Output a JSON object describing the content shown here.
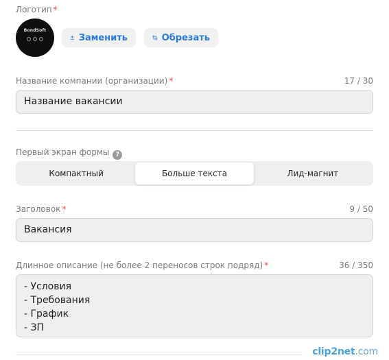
{
  "logo": {
    "label": "Логотип",
    "required_mark": "*",
    "logo_text": "BondSoft",
    "replace_button": "Заменить",
    "crop_button": "Обрезать"
  },
  "company": {
    "label": "Название компании (организации)",
    "required_mark": "*",
    "counter": "17 / 30",
    "value": "Название вакансии"
  },
  "first_screen": {
    "label": "Первый экран формы",
    "help": "?",
    "options": [
      "Компактный",
      "Больше текста",
      "Лид-магнит"
    ],
    "selected": "Больше текста"
  },
  "heading": {
    "label": "Заголовок",
    "required_mark": "*",
    "counter": "9 / 50",
    "value": "Вакансия"
  },
  "description": {
    "label": "Длинное описание (не более 2 переносов строк подряд)",
    "required_mark": "*",
    "counter": "36 / 350",
    "lines": [
      "- Условия",
      "- Требования",
      "- График",
      "- ЗП"
    ]
  },
  "watermark": {
    "brand": "clip2net",
    "suffix": ".com"
  },
  "colors": {
    "accent": "#2a7ae2",
    "required": "#e5484d"
  }
}
